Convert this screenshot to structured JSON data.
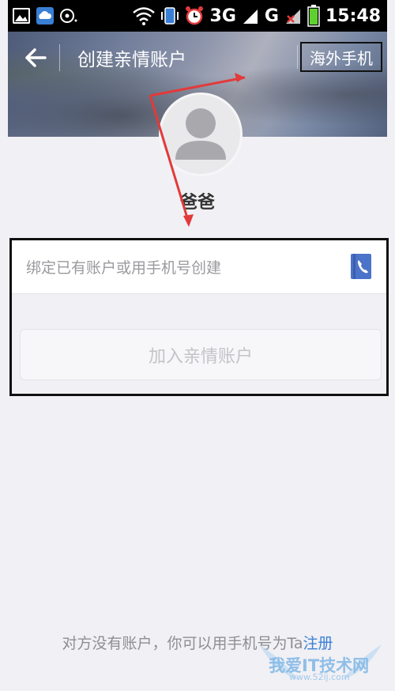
{
  "status_bar": {
    "network_3g": "3G",
    "network_g": "G",
    "time": "15:48",
    "icons": [
      "gallery-icon",
      "cloud-icon",
      "media-icon",
      "wifi-icon",
      "vibrate-icon",
      "alarm-icon",
      "signal-icon",
      "signal-x-icon",
      "battery-icon"
    ]
  },
  "header": {
    "title": "创建亲情账户",
    "overseas_label": "海外手机",
    "back_icon": "back-arrow-icon"
  },
  "profile": {
    "name": "爸爸",
    "avatar_icon": "default-avatar-icon"
  },
  "form": {
    "input_placeholder": "绑定已有账户或用手机号创建",
    "phone_icon": "phone-book-icon",
    "join_button": "加入亲情账户"
  },
  "footer": {
    "hint_text": "对方没有账户，你可以用手机号为Ta",
    "register_link": "注册"
  },
  "watermark": {
    "text": "我爱IT技术网",
    "url": "www.52ij.com"
  },
  "colors": {
    "annotation_red": "#e23a3a",
    "link_blue": "#3a7fd6",
    "background": "#f1f0f4"
  }
}
